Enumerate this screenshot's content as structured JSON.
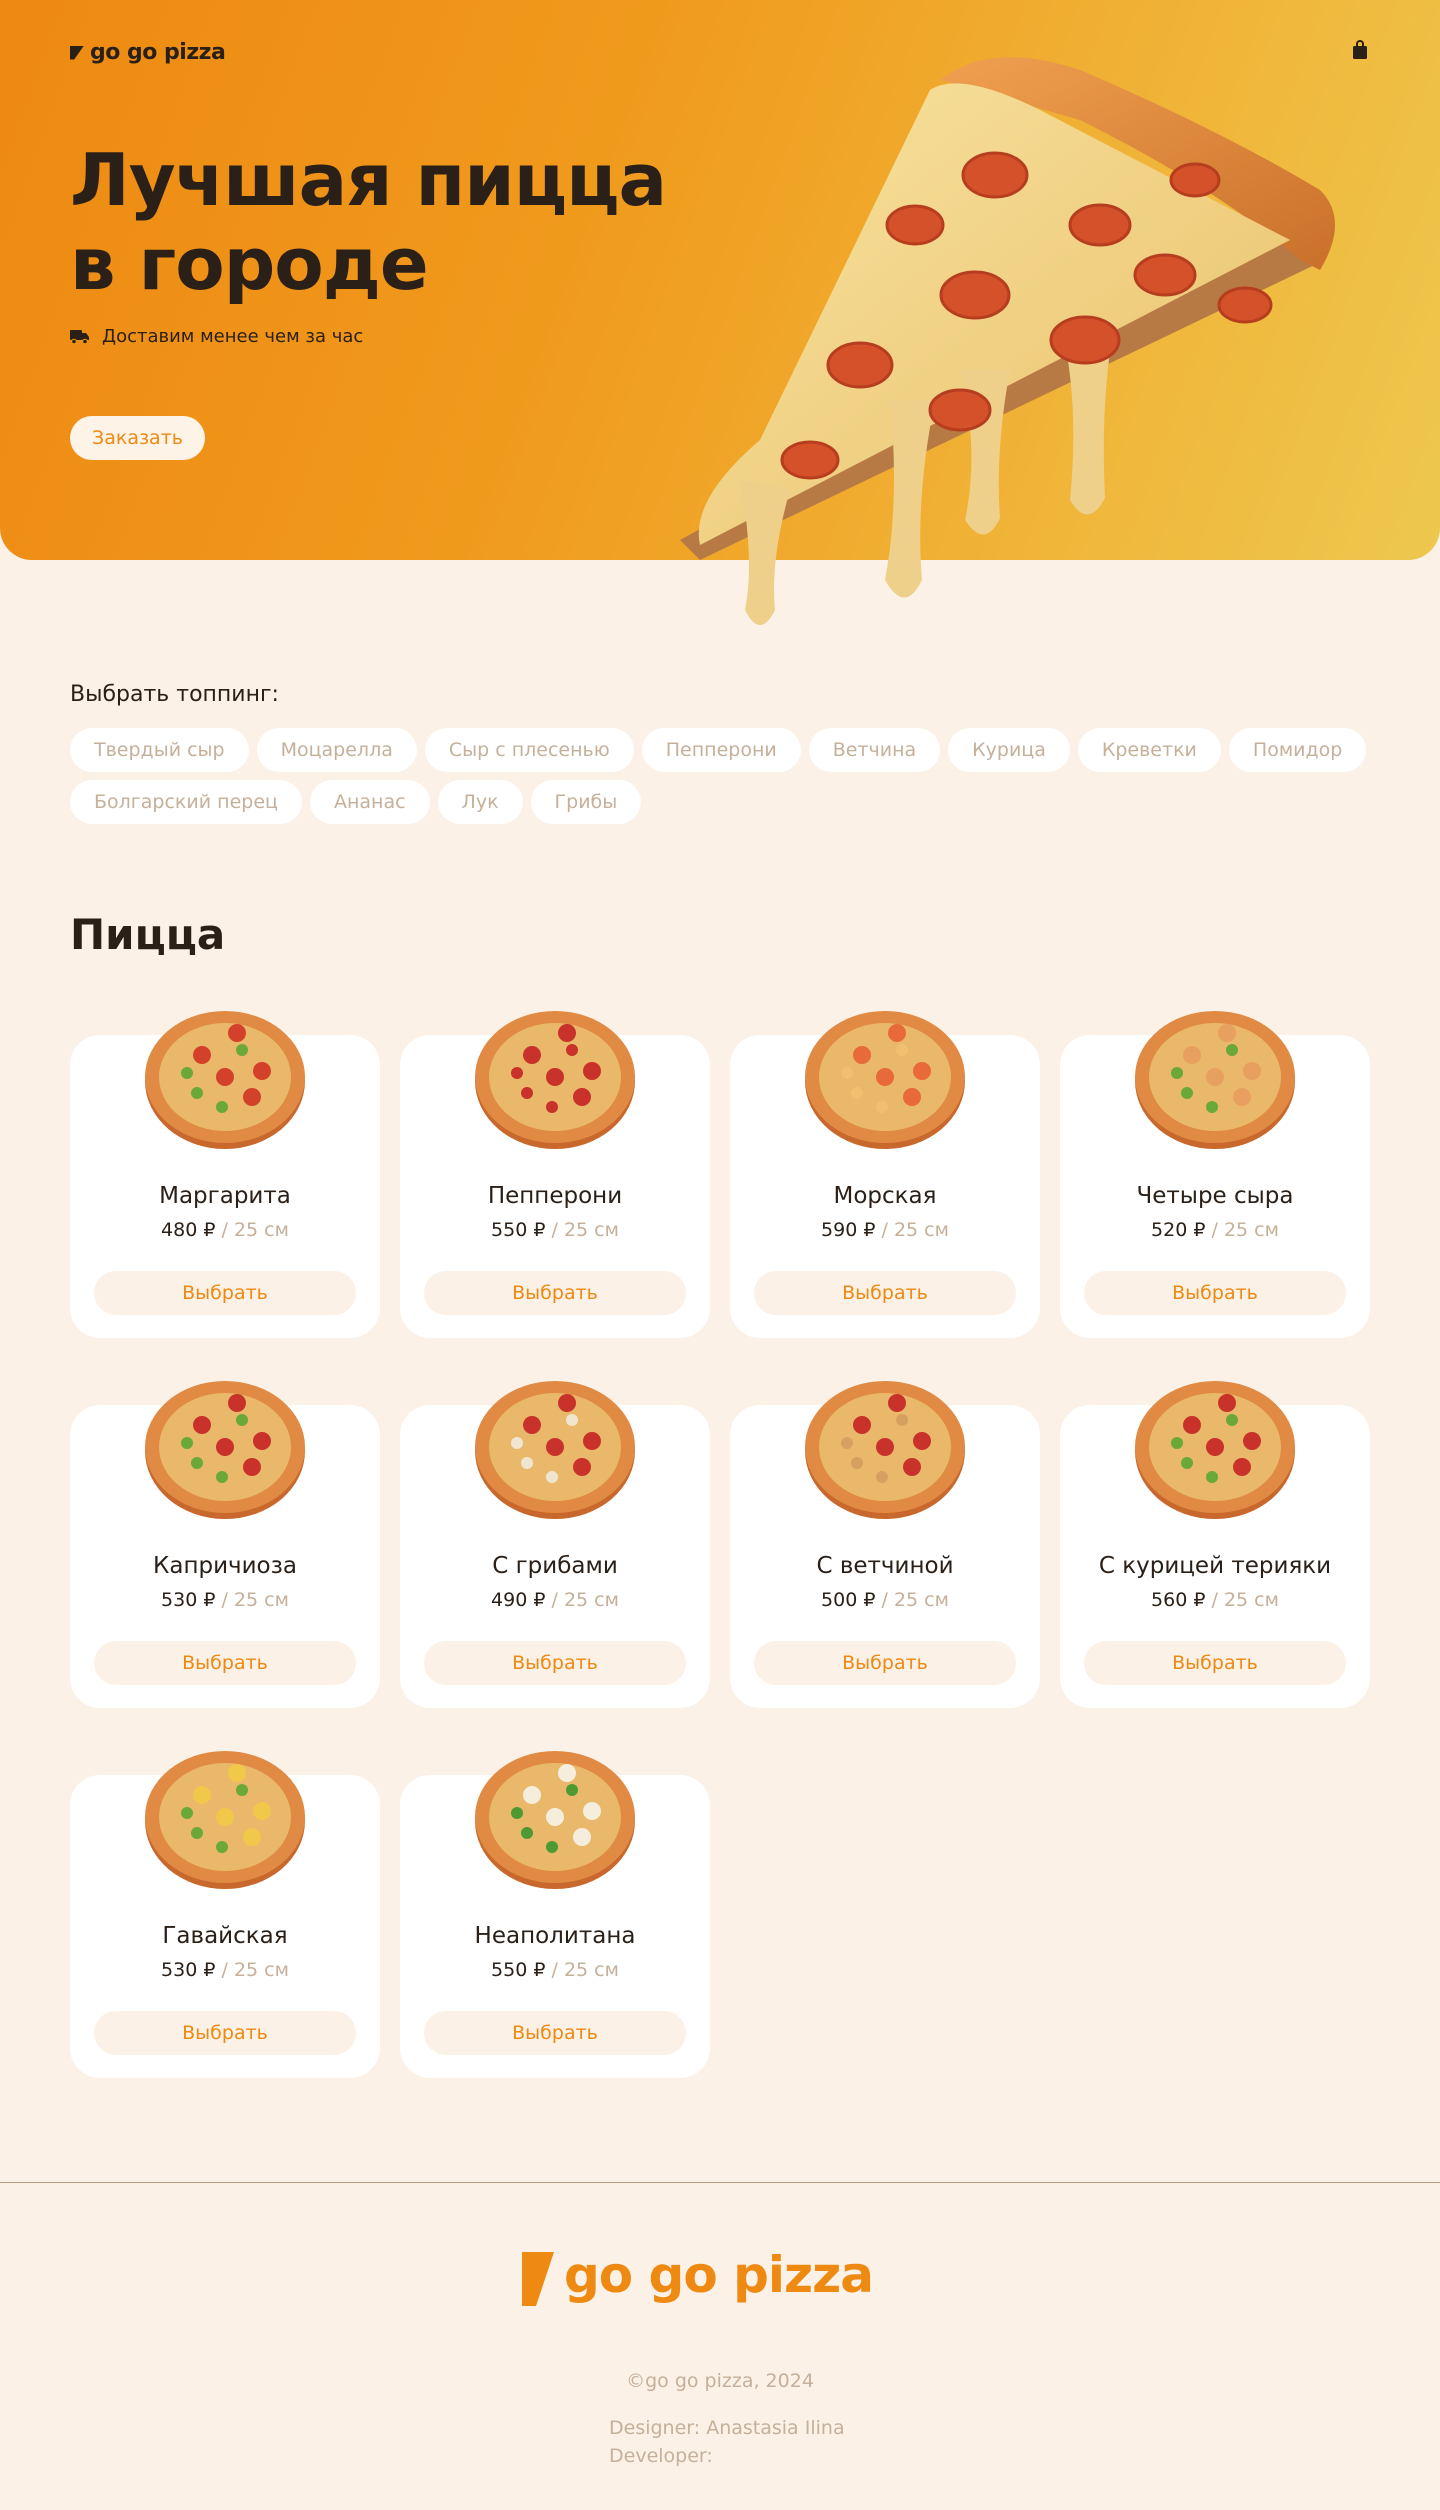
{
  "brand": {
    "name": "go go pizza"
  },
  "header": {
    "cart_icon": "shopping-bag-icon"
  },
  "hero": {
    "title_line1": "Лучшая пицца",
    "title_line2": "в городе",
    "delivery_text": "Доставим менее чем за час",
    "order_button": "Заказать"
  },
  "toppings": {
    "label": "Выбрать топпинг:",
    "items": [
      "Твердый сыр",
      "Моцарелла",
      "Сыр с плесенью",
      "Пепперони",
      "Ветчина",
      "Курица",
      "Креветки",
      "Помидор",
      "Болгарский перец",
      "Ананас",
      "Лук",
      "Грибы"
    ]
  },
  "menu": {
    "title": "Пицца",
    "separator": "/",
    "choose_label": "Выбрать",
    "items": [
      {
        "name": "Маргарита",
        "price": "480 ₽",
        "size": "25 см"
      },
      {
        "name": "Пепперони",
        "price": "550 ₽",
        "size": "25 см"
      },
      {
        "name": "Морская",
        "price": "590 ₽",
        "size": "25 см"
      },
      {
        "name": "Четыре сыра",
        "price": "520 ₽",
        "size": "25 см"
      },
      {
        "name": "Капричиоза",
        "price": "530 ₽",
        "size": "25 см"
      },
      {
        "name": "С грибами",
        "price": "490 ₽",
        "size": "25 см"
      },
      {
        "name": "С ветчиной",
        "price": "500 ₽",
        "size": "25 см"
      },
      {
        "name": "С курицей терияки",
        "price": "560 ₽",
        "size": "25 см"
      },
      {
        "name": "Гавайская",
        "price": "530 ₽",
        "size": "25 см"
      },
      {
        "name": "Неаполитана",
        "price": "550 ₽",
        "size": "25 см"
      }
    ]
  },
  "footer": {
    "copyright": "©go go pizza, 2024",
    "designer": "Designer: Anastasia Ilina",
    "developer": "Developer:"
  },
  "colors": {
    "accent": "#EE8912",
    "background": "#FBF1E6",
    "text": "#2B2018",
    "muted": "#C5B09A"
  }
}
